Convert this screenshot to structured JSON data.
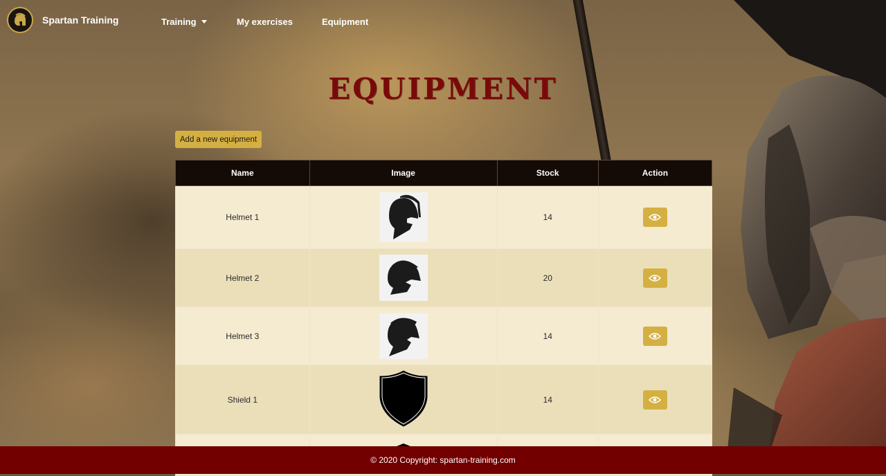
{
  "nav": {
    "brand": "Spartan Training",
    "links": [
      "Training",
      "My exercises",
      "Equipment"
    ]
  },
  "page": {
    "title": "Equipment",
    "add_button": "Add a new equipment"
  },
  "table": {
    "headers": [
      "Name",
      "Image",
      "Stock",
      "Action"
    ],
    "rows": [
      {
        "name": "Helmet 1",
        "image_icon": "helmet-icon",
        "stock": "14"
      },
      {
        "name": "Helmet 2",
        "image_icon": "helmet-icon",
        "stock": "20"
      },
      {
        "name": "Helmet 3",
        "image_icon": "helmet-icon",
        "stock": "14"
      },
      {
        "name": "Shield 1",
        "image_icon": "shield-icon",
        "stock": "14"
      }
    ],
    "action_icon": "eye-icon"
  },
  "footer": {
    "text": "© 2020 Copyright: spartan-training.com"
  },
  "colors": {
    "accent": "#d4b043",
    "title": "#7a0a0a",
    "header_bg": "#140a06",
    "footer_bg": "#720000",
    "row_light": "#f5ebd1",
    "row_dark": "#ebdfba"
  }
}
